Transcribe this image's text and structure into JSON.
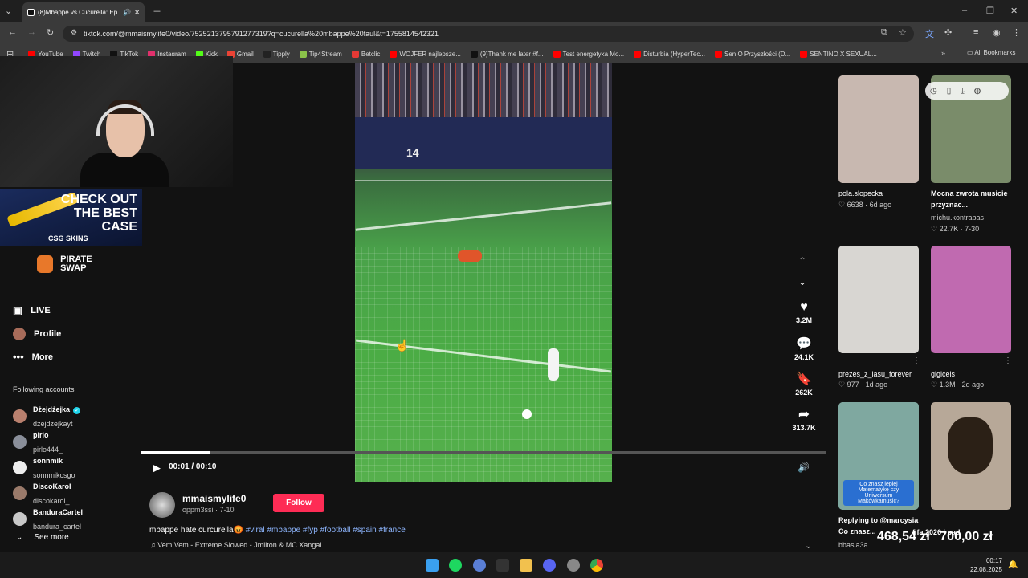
{
  "browser": {
    "tab_title": "(8)Mbappe vs Cucurella: Ep",
    "url": "tiktok.com/@mmaismylife0/video/7525213795791277319?q=cucurella%20mbappe%20faul&t=1755814542321",
    "bookmarks": [
      {
        "label": "YouTube",
        "color": "#ff0000"
      },
      {
        "label": "Twitch",
        "color": "#9146ff"
      },
      {
        "label": "TikTok",
        "color": "#111111"
      },
      {
        "label": "Instagram",
        "color": "#e1306c"
      },
      {
        "label": "Kick",
        "color": "#53fc18"
      },
      {
        "label": "Gmail",
        "color": "#ea4335"
      },
      {
        "label": "Tipply",
        "color": "#222222"
      },
      {
        "label": "Tip4Stream",
        "color": "#8bc34a"
      },
      {
        "label": "Betclic",
        "color": "#e53935"
      },
      {
        "label": "WOJFER najlepsze...",
        "color": "#ff0000"
      },
      {
        "label": "(9)Thank me later #f...",
        "color": "#111111"
      },
      {
        "label": "Test energetyka Mo...",
        "color": "#ff0000"
      },
      {
        "label": "Disturbia (HyperTec...",
        "color": "#ff0000"
      },
      {
        "label": "Sen O Przyszłości (D...",
        "color": "#ff0000"
      },
      {
        "label": "SENTINO X SEXUAL...",
        "color": "#ff0000"
      }
    ],
    "all_bookmarks": "All Bookmarks"
  },
  "stream": {
    "csgo_banner": "CHECK OUT THE BEST CASE",
    "csgo_brand": "CSG SKINS",
    "pirate_line1": "PIRATE",
    "pirate_line2": "SWAP"
  },
  "sidebar": {
    "nav": [
      {
        "label": "LIVE",
        "icon": "live-icon"
      },
      {
        "label": "Profile",
        "icon": "profile-icon"
      },
      {
        "label": "More",
        "icon": "more-icon"
      }
    ],
    "following_title": "Following accounts",
    "accounts": [
      {
        "name": "Dżejdżejka",
        "handle": "dzejdzejkayt",
        "verified": true
      },
      {
        "name": "pirlo",
        "handle": "pirlo444_"
      },
      {
        "name": "sonnmik",
        "handle": "sonnmikcsgo"
      },
      {
        "name": "DiscoKarol",
        "handle": "discokarol_"
      },
      {
        "name": "BanduraCartel",
        "handle": "bandura_cartel"
      }
    ],
    "see_more": "See more"
  },
  "video": {
    "time": "00:01 / 00:10",
    "progress_fraction": 0.1,
    "likes": "3.2M",
    "comments": "24.1K",
    "saves": "262K",
    "shares": "313.7K",
    "author": "mmaismylife0",
    "author_sub": "oppm3ssi · 7-10",
    "follow_label": "Follow",
    "caption_text": "mbappe hate curcurella😡",
    "hashtags": [
      "#viral",
      "#mbappe",
      "#fyp",
      "#football",
      "#spain",
      "#france"
    ],
    "music": "♫ Vem Vem - Extreme Slowed - Jmilton & MC Xangai"
  },
  "grid": [
    {
      "user": "pola.slopecka",
      "stat": "♡ 6638 · 6d ago",
      "color": "#c8b8b0"
    },
    {
      "title": "Mocna zwrota musicie przyznac...",
      "user": "michu.kontrabas",
      "stat": "♡ 22.7K · 7-30",
      "color": "#7a8c6a"
    },
    {
      "user": "prezes_z_lasu_forever",
      "stat": "♡ 977 · 1d ago",
      "color": "#d8d6d2"
    },
    {
      "user": "gigicels",
      "stat": "♡ 1.3M · 2d ago",
      "color": "#c06ab0"
    },
    {
      "title": "Replying to @marcysia Co znasz...",
      "user": "bbasia3a",
      "stat": "",
      "color": "#7fa8a0",
      "overlay": "Co znasz lepiej Matematykę czy Uniwersum Makówkamusic?"
    },
    {
      "title": "",
      "user": "",
      "stat": "",
      "color": "#b7a898"
    }
  ],
  "overlay": {
    "left_amount": "468,54 zł",
    "right_amount": "700,00 zł",
    "label": "fifa 2026 i pad"
  },
  "taskbar": {
    "time": "00:17",
    "date": "22.08.2025"
  }
}
